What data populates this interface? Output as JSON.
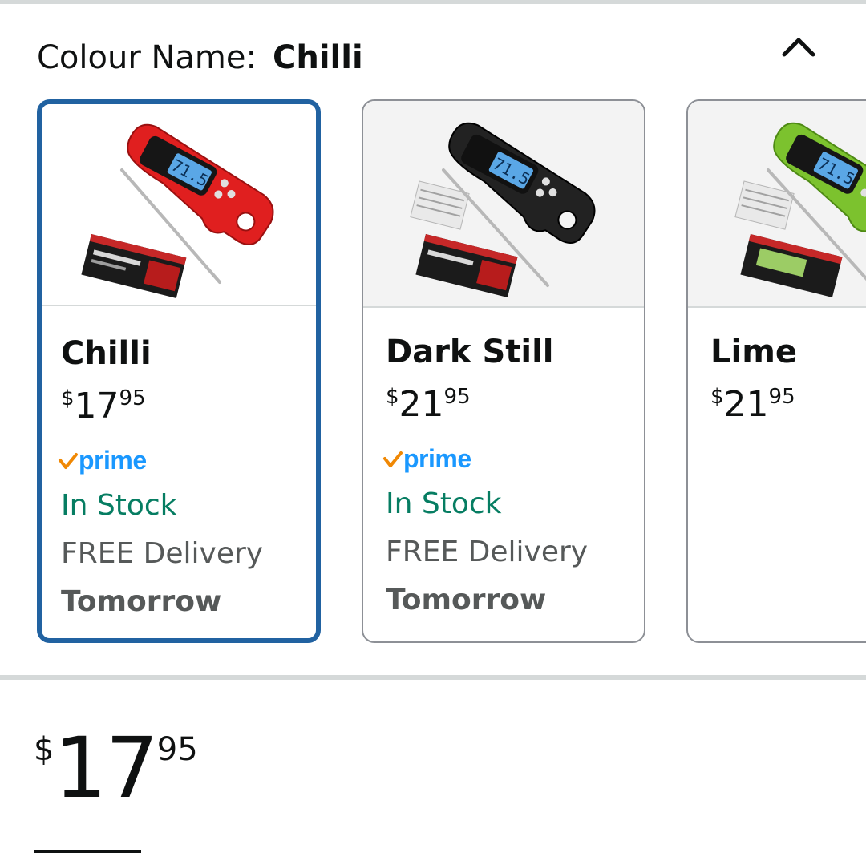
{
  "colour_selector": {
    "label": "Colour Name:",
    "selected_value": "Chilli",
    "collapse_icon": "chevron-up-icon"
  },
  "options": [
    {
      "name": "Chilli",
      "price": {
        "symbol": "$",
        "whole": "17",
        "fraction": "95"
      },
      "prime": "prime",
      "stock": "In Stock",
      "delivery": "FREE Delivery",
      "delivery_when": "Tomorrow",
      "selected": true,
      "color": "#e01f1f"
    },
    {
      "name": "Dark Still",
      "price": {
        "symbol": "$",
        "whole": "21",
        "fraction": "95"
      },
      "prime": "prime",
      "stock": "In Stock",
      "delivery": "FREE Delivery",
      "delivery_when": "Tomorrow",
      "selected": false,
      "color": "#222222"
    },
    {
      "name": "Lime",
      "price": {
        "symbol": "$",
        "whole": "21",
        "fraction": "95"
      },
      "selected": false,
      "color": "#7cc22e"
    }
  ],
  "current_price": {
    "symbol": "$",
    "whole": "17",
    "fraction": "95"
  },
  "colors": {
    "selected_border": "#2162a1",
    "in_stock": "#067d62",
    "prime_blue": "#1a98ff",
    "prime_check": "#f08804"
  }
}
